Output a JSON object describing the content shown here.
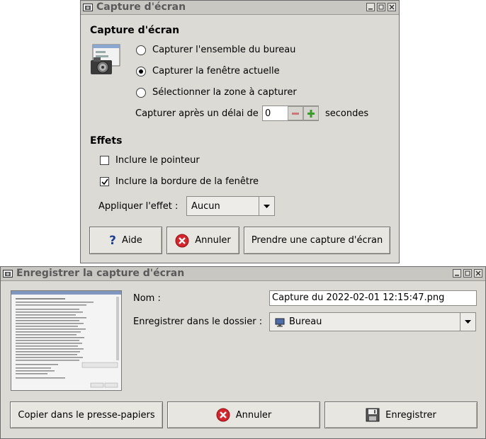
{
  "screenshot_window": {
    "title": "Capture d'écran",
    "section_capture": "Capture d'écran",
    "options": [
      {
        "label": "Capturer l'ensemble du bureau",
        "selected": false
      },
      {
        "label": "Capturer la fenêtre actuelle",
        "selected": true
      },
      {
        "label": "Sélectionner la zone à capturer",
        "selected": false
      }
    ],
    "delay_label": "Capturer après un délai de",
    "delay_value": "0",
    "delay_unit": "secondes",
    "section_effects": "Effets",
    "include_pointer": {
      "label": "Inclure le pointeur",
      "checked": false
    },
    "include_border": {
      "label": "Inclure la bordure de la fenêtre",
      "checked": true
    },
    "effect_label": "Appliquer l'effet :",
    "effect_value": "Aucun",
    "buttons": {
      "help": "Aide",
      "cancel": "Annuler",
      "take": "Prendre une capture d'écran"
    }
  },
  "save_window": {
    "title": "Enregistrer la capture d'écran",
    "name_label": "Nom :",
    "name_value": "Capture du 2022-02-01 12:15:47.png",
    "folder_label": "Enregistrer dans le dossier :",
    "folder_value": "Bureau",
    "buttons": {
      "copy": "Copier dans le presse-papiers",
      "cancel": "Annuler",
      "save": "Enregistrer"
    }
  },
  "colors": {
    "window_bg": "#dcdad5",
    "cancel_red": "#d8232a",
    "help_blue": "#1c3f94",
    "plus_green": "#3a9a2a"
  }
}
